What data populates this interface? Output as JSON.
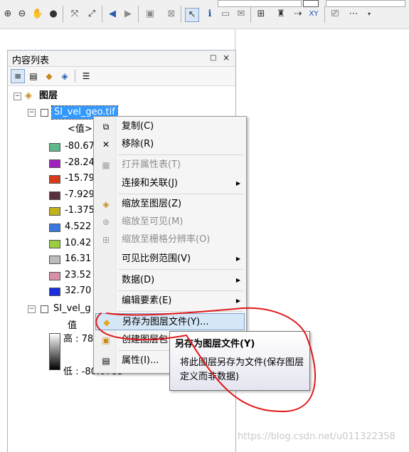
{
  "toolbar": {
    "icons": [
      "zoom-in-icon",
      "zoom-out-icon",
      "pan-icon",
      "globe-icon",
      "full-extent-icon",
      "fixed-zoom-icon",
      "back-icon",
      "forward-icon",
      "select-features-icon",
      "clear-selection-icon",
      "select-elements-icon",
      "identify-icon",
      "html-popup-icon",
      "measure-icon",
      "find-icon",
      "route-icon",
      "go-to-xy-icon"
    ]
  },
  "toc": {
    "title": "内容列表",
    "pin_glyph": "□",
    "close_glyph": "×"
  },
  "tree": {
    "root_label": "图层",
    "layer1": {
      "name": "SI_vel_geo.tif",
      "value_header": "<值>",
      "classes": [
        {
          "label": "-80.67",
          "color": "#5fb98a"
        },
        {
          "label": "-28.24",
          "color": "#a020c0"
        },
        {
          "label": "-15.79",
          "color": "#d83a1c"
        },
        {
          "label": "-7.929",
          "color": "#5a3040"
        },
        {
          "label": "-1.375",
          "color": "#c2b21c"
        },
        {
          "label": "4.522",
          "color": "#3a78e0"
        },
        {
          "label": "10.42",
          "color": "#9ace3e"
        },
        {
          "label": "16.31",
          "color": "#bcbcbc"
        },
        {
          "label": "23.52",
          "color": "#d98fa5"
        },
        {
          "label": "32.70",
          "color": "#1a2ee0"
        }
      ]
    },
    "layer2": {
      "name": "SI_vel_g",
      "value_label": "值",
      "high_label": "高 : 78",
      "low_label": "低 : -80.6783"
    }
  },
  "context_menu": {
    "items": [
      {
        "label": "复制(C)",
        "icon": "copy-icon"
      },
      {
        "label": "移除(R)",
        "icon": "remove-icon"
      },
      {
        "label": "打开属性表(T)",
        "icon": "table-icon"
      },
      {
        "label": "连接和关联(J)",
        "icon": ""
      },
      {
        "label": "缩放至图层(Z)",
        "icon": "zoom-layer-icon"
      },
      {
        "label": "缩放至可见(M)",
        "icon": "zoom-visible-icon"
      },
      {
        "label": "缩放至栅格分辨率(O)",
        "icon": "zoom-raster-icon"
      },
      {
        "label": "可见比例范围(V)",
        "icon": ""
      },
      {
        "label": "数据(D)",
        "icon": ""
      },
      {
        "label": "编辑要素(E)",
        "icon": ""
      },
      {
        "label": "另存为图层文件(Y)...",
        "icon": "save-layer-icon"
      },
      {
        "label": "创建图层包",
        "icon": "layer-package-icon"
      },
      {
        "label": "属性(I)...",
        "icon": "properties-icon"
      }
    ]
  },
  "tooltip": {
    "title": "另存为图层文件(Y)",
    "body": "将此图层另存为文件(保存图层定义而非数据)"
  },
  "watermark": "https://blog.csdn.net/u011322358",
  "colors": {
    "selection": "#3399ff",
    "annotation": "#e01818"
  }
}
